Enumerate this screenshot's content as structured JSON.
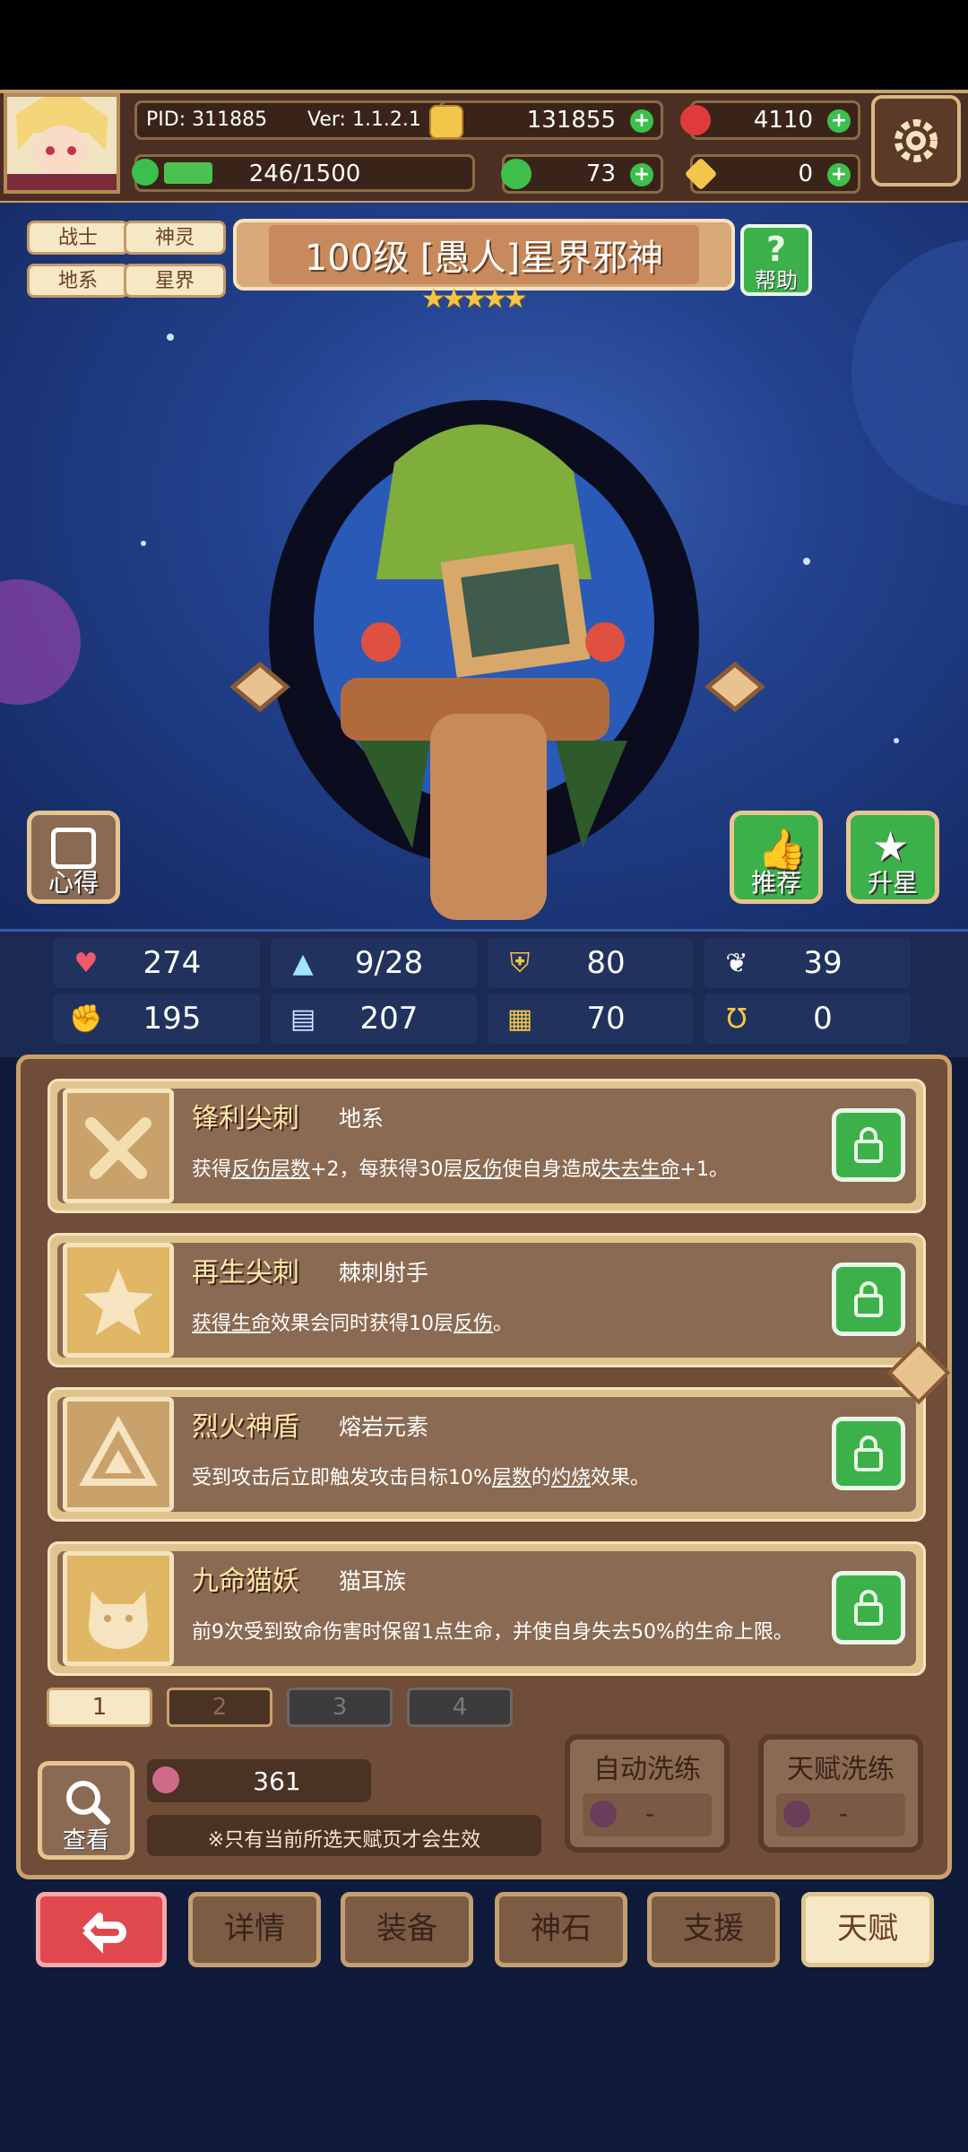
{
  "hud": {
    "pid": "PID: 311885",
    "version": "Ver: 1.1.2.1",
    "gold": "131855",
    "gems": "4110",
    "energy": "246/1500",
    "energy_fraction": 0.164,
    "clover": "73",
    "key": "0"
  },
  "tags": [
    "战士",
    "神灵",
    "地系",
    "星界"
  ],
  "title": "100级 [愚人]星界邪神",
  "stars": 5,
  "help_label": "帮助",
  "side_buttons": {
    "insight": "心得",
    "recommend": "推荐",
    "star_up": "升星"
  },
  "stats": [
    {
      "icon": "heart-icon",
      "value": "274"
    },
    {
      "icon": "water-drop-icon",
      "value": "9/28"
    },
    {
      "icon": "shield-icon",
      "value": "80"
    },
    {
      "icon": "wing-icon",
      "value": "39"
    },
    {
      "icon": "fist-icon",
      "value": "195"
    },
    {
      "icon": "book-icon",
      "value": "207"
    },
    {
      "icon": "card-icon",
      "value": "70"
    },
    {
      "icon": "horseshoe-icon",
      "value": "0"
    }
  ],
  "talents": [
    {
      "name": "锋利尖刺",
      "sub": "地系",
      "desc_html": "获得<u>反伤层数</u>+2，每获得30层<u>反伤</u>使自身造成<u>失去生命</u>+1。"
    },
    {
      "name": "再生尖刺",
      "sub": "棘刺射手",
      "desc_html": "<u>获得生命</u>效果会同时获得10层<u>反伤</u>。"
    },
    {
      "name": "烈火神盾",
      "sub": "熔岩元素",
      "desc_html": "受到攻击后立即触发攻击目标10%<u>层数</u>的<u>灼烧</u>效果。"
    },
    {
      "name": "九命猫妖",
      "sub": "猫耳族",
      "desc_html": "前9次受到致命伤害时保留1点生命，并使自身失去50%的生命上限。"
    }
  ],
  "pages": [
    "1",
    "2",
    "3",
    "4"
  ],
  "view_label": "查看",
  "currency_value": "361",
  "note": "※只有当前所选天赋页才会生效",
  "auto_reroll": {
    "label": "自动洗练",
    "value": "-"
  },
  "talent_reroll": {
    "label": "天赋洗练",
    "value": "-"
  },
  "nav": [
    "详情",
    "装备",
    "神石",
    "支援",
    "天赋"
  ],
  "colors": {
    "accent_green": "#3cc04b",
    "back_red": "#e0484d",
    "panel_brown": "#6f4d38",
    "gold_border": "#c9a16b"
  }
}
